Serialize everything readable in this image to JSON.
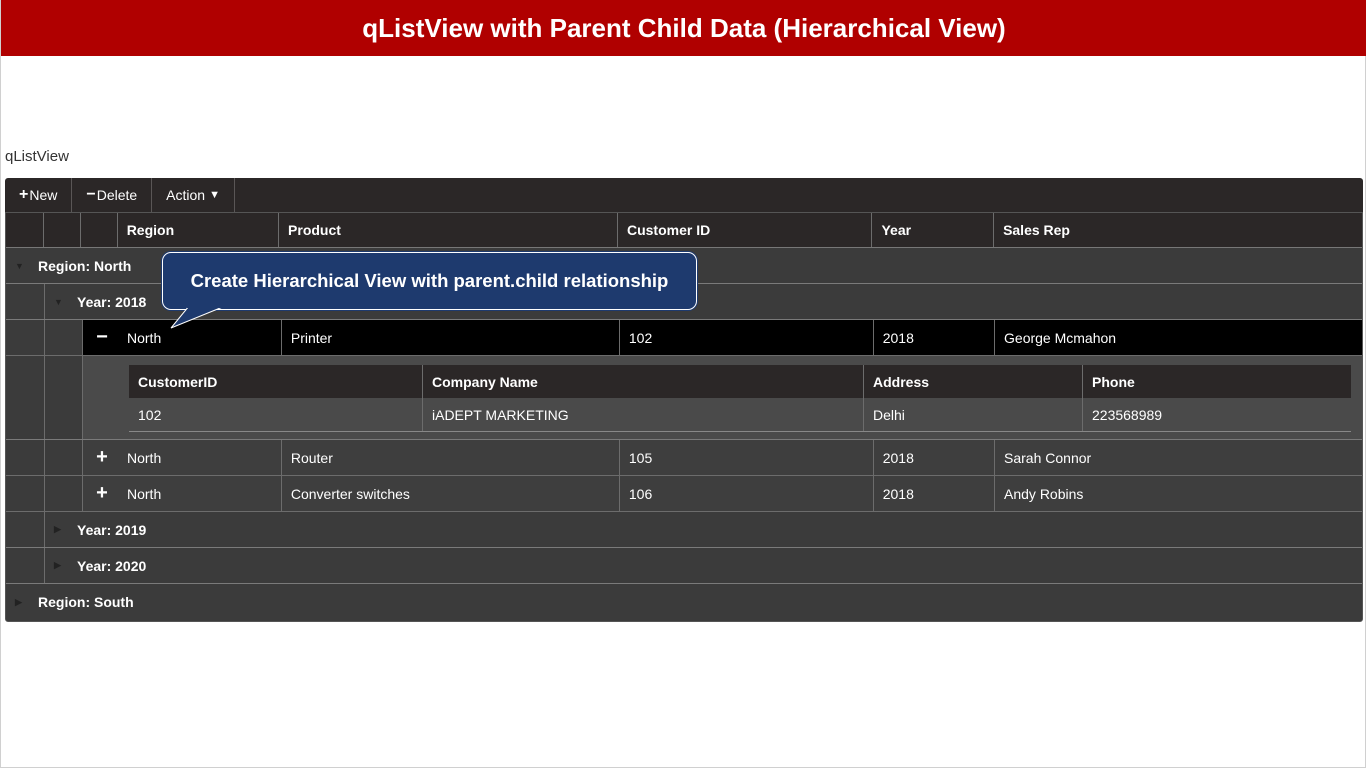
{
  "title": "qListView with Parent Child Data (Hierarchical View)",
  "component_label": "qListView",
  "toolbar": {
    "new_label": "New",
    "delete_label": "Delete",
    "action_label": "Action"
  },
  "columns": {
    "region": "Region",
    "product": "Product",
    "customer_id": "Customer ID",
    "year": "Year",
    "sales_rep": "Sales Rep"
  },
  "groups": {
    "region_north": "Region: North",
    "year_2018": "Year: 2018",
    "year_2019": "Year: 2019",
    "year_2020": "Year: 2020",
    "region_south": "Region: South"
  },
  "rows": [
    {
      "expander": "−",
      "region": "North",
      "product": "Printer",
      "customer_id": "102",
      "year": "2018",
      "sales_rep": "George Mcmahon"
    },
    {
      "expander": "+",
      "region": "North",
      "product": "Router",
      "customer_id": "105",
      "year": "2018",
      "sales_rep": "Sarah Connor"
    },
    {
      "expander": "+",
      "region": "North",
      "product": "Converter switches",
      "customer_id": "106",
      "year": "2018",
      "sales_rep": "Andy Robins"
    }
  ],
  "detail": {
    "headers": {
      "customer_id": "CustomerID",
      "company_name": "Company Name",
      "address": "Address",
      "phone": "Phone"
    },
    "row": {
      "customer_id": "102",
      "company_name": "iADEPT MARKETING",
      "address": "Delhi",
      "phone": "223568989"
    }
  },
  "callout_text": "Create Hierarchical View with parent.child relationship",
  "colors": {
    "title_bg": "#b00000",
    "toolbar_bg": "#2b2727",
    "grid_bg": "#3b3b3b",
    "selected_row_bg": "#000000",
    "callout_bg": "#1e3a6e"
  }
}
